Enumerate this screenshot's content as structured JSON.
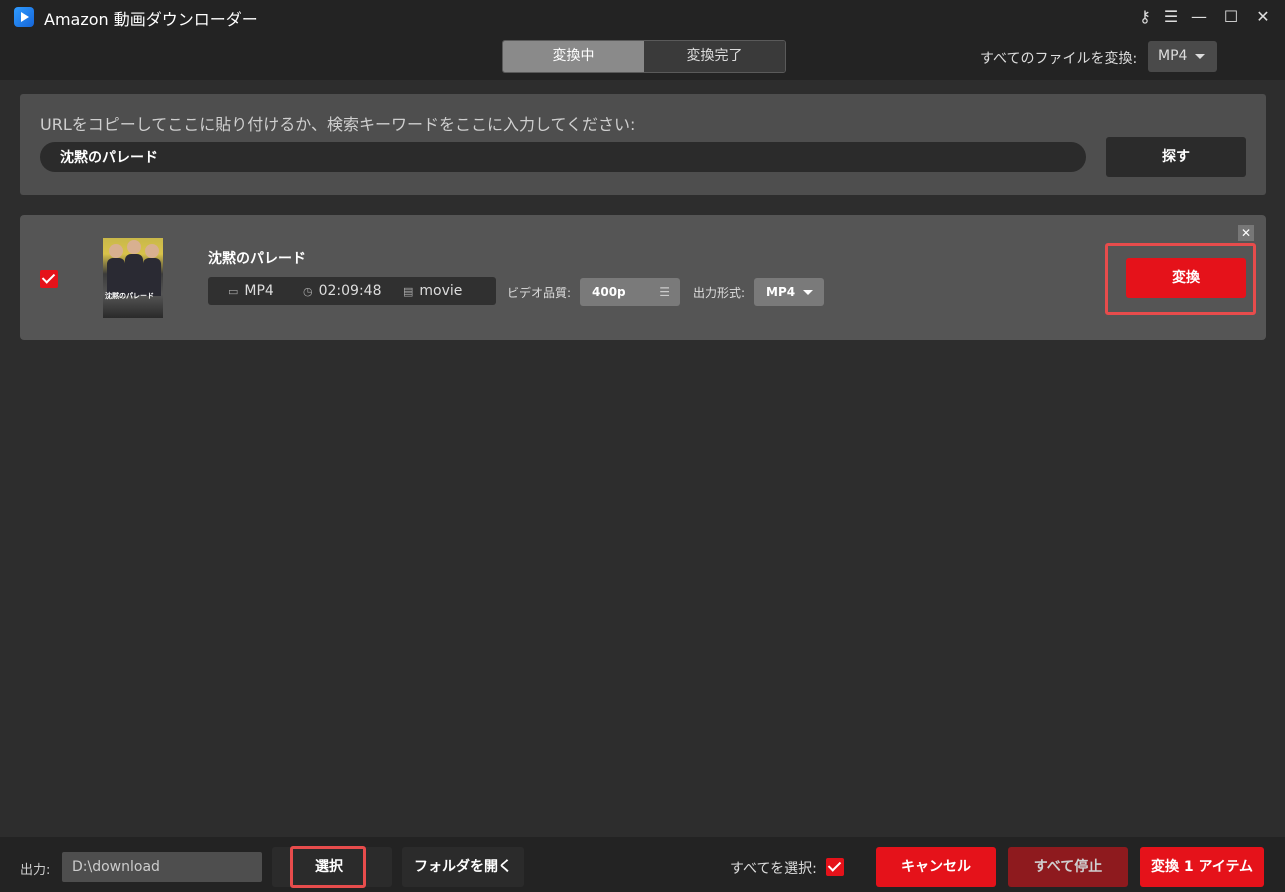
{
  "app": {
    "title": "Amazon 動画ダウンローダー"
  },
  "window_controls": {
    "key": "⚷",
    "menu": "☰",
    "minimize": "—",
    "maximize": "☐",
    "close": "✕"
  },
  "tabs": [
    {
      "label": "変換中",
      "active": true
    },
    {
      "label": "変換完了",
      "active": false
    }
  ],
  "convert_all": {
    "label": "すべてのファイルを変換:",
    "format": "MP4"
  },
  "search": {
    "prompt": "URLをコピーしてここに貼り付けるか、検索キーワードをここに入力してください:",
    "value": "沈黙のパレード",
    "button": "探す"
  },
  "item": {
    "checked": true,
    "title": "沈黙のパレード",
    "thumbnail_text": "沈黙のパレード",
    "format": "MP4",
    "duration": "02:09:48",
    "type": "movie",
    "quality_label": "ビデオ品質:",
    "quality": "400p",
    "output_format_label": "出力形式:",
    "output_format": "MP4",
    "convert_button": "変換"
  },
  "footer": {
    "output_label": "出力:",
    "output_path": "D:\\download",
    "select_button": "選択",
    "open_folder_button": "フォルダを開く",
    "select_all_label": "すべてを選択:",
    "cancel_button": "キャンセル",
    "stop_all_button": "すべて停止",
    "convert_items_button": "変換 1 アイテム"
  },
  "colors": {
    "accent": "#e5121a",
    "highlight": "#e74c4c",
    "background": "#2d2d2d",
    "panel": "#4e4e4e"
  }
}
